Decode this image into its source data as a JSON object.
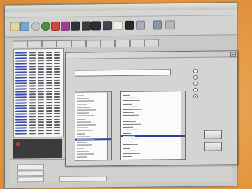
{
  "app": {
    "tabs": [
      "",
      "",
      "",
      "",
      "",
      "",
      "",
      "",
      "",
      ""
    ]
  },
  "statusbar": {
    "rows": [
      {
        "label": "",
        "value": ""
      },
      {
        "label": "",
        "value": ""
      },
      {
        "label": "",
        "value": ""
      }
    ]
  },
  "dialog": {
    "field_label": "",
    "left_list_label": "",
    "right_list_label": "",
    "left_list_items": [
      "",
      "",
      "",
      "",
      "",
      "",
      "",
      "",
      "",
      "",
      "",
      "",
      "",
      "",
      "",
      "",
      "",
      "",
      "",
      "",
      "",
      ""
    ],
    "left_list_selected_index": 15,
    "right_list_items": [
      "",
      "",
      "",
      "",
      "",
      "",
      "",
      "",
      "",
      "",
      "",
      "",
      "",
      "",
      "",
      "",
      "",
      "",
      "",
      "",
      "",
      ""
    ],
    "right_list_selected_index": 14,
    "options_label": "",
    "options": [
      {
        "label": "",
        "checked": false
      },
      {
        "label": "",
        "checked": false
      },
      {
        "label": "",
        "checked": false
      },
      {
        "label": "",
        "checked": false
      },
      {
        "label": "",
        "checked": true
      }
    ],
    "ok_label": "",
    "cancel_label": ""
  },
  "colors": {
    "selection": "#2e3fa0",
    "background": "#e8a14e",
    "window": "#c9c9c7"
  }
}
